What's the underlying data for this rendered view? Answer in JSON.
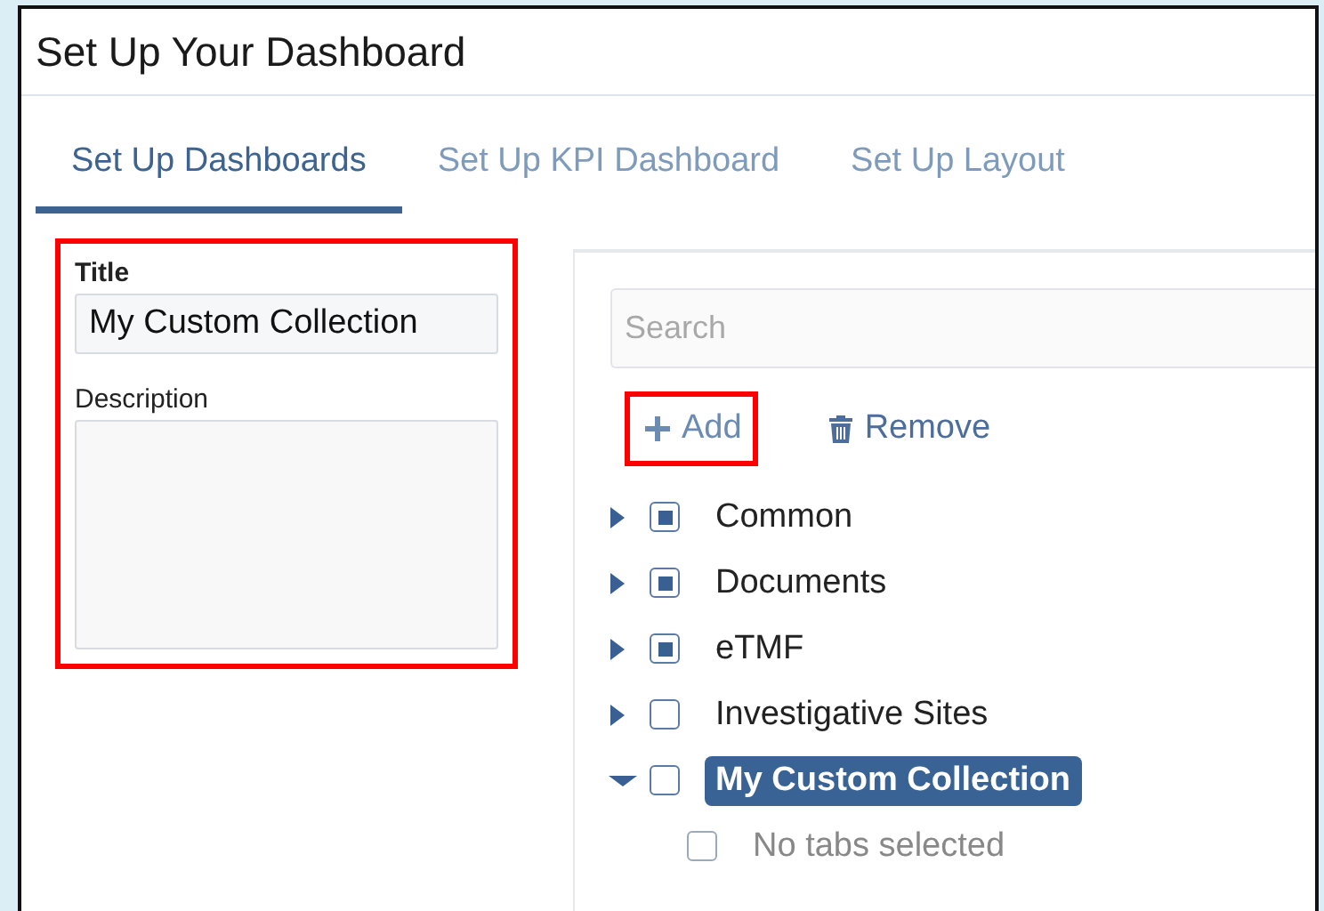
{
  "window": {
    "title": "Set Up Your Dashboard"
  },
  "tabs": [
    {
      "label": "Set Up Dashboards",
      "selected": true
    },
    {
      "label": "Set Up KPI Dashboard",
      "selected": false
    },
    {
      "label": "Set Up Layout",
      "selected": false
    }
  ],
  "form": {
    "annotated": true,
    "title_label": "Title",
    "title_value": "My Custom Collection",
    "description_label": "Description"
  },
  "search": {
    "placeholder": "Search"
  },
  "actions": [
    {
      "kind": "add",
      "label": "Add",
      "annotated": true
    },
    {
      "kind": "remove",
      "label": "Remove",
      "annotated": false
    }
  ],
  "tree": [
    {
      "label": "Common",
      "partial": true,
      "expanded": false,
      "selected": false,
      "disabled": false
    },
    {
      "label": "Documents",
      "partial": true,
      "expanded": false,
      "selected": false,
      "disabled": false
    },
    {
      "label": "eTMF",
      "partial": true,
      "expanded": false,
      "selected": false,
      "disabled": false
    },
    {
      "label": "Investigative Sites",
      "partial": false,
      "expanded": false,
      "selected": false,
      "disabled": false
    },
    {
      "label": "My Custom Collection",
      "partial": false,
      "expanded": true,
      "selected": true,
      "disabled": false,
      "children": [
        {
          "label": "No tabs selected",
          "partial": false,
          "selected": false,
          "disabled": true
        }
      ]
    }
  ]
}
